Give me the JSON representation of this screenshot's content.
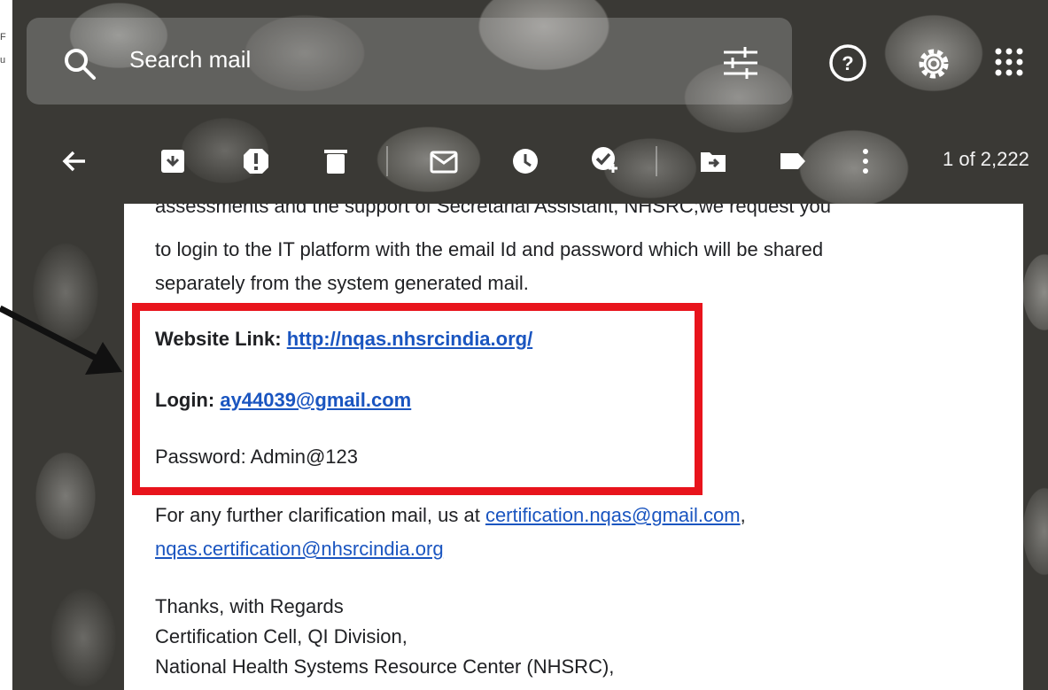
{
  "fragment_letters": [
    "F",
    "u"
  ],
  "search": {
    "placeholder": "Search mail"
  },
  "toolbar": {
    "pager": "1 of 2,222"
  },
  "email": {
    "lines": [
      "assessments and the support of Secretarial Assistant, NHSRC;we request you",
      "to login to the IT platform with the email Id and password which will be shared",
      "separately from the system generated mail."
    ],
    "website_label": "Website Link:",
    "website_link": "http://nqas.nhsrcindia.org/",
    "login_label": "Login:",
    "login_value": "ay44039@gmail.com",
    "password_line": "Password: Admin@123",
    "clarification_text": "For any further clarification mail, us at",
    "clarification_email_1": "certification.nqas@gmail.com",
    "clarification_sep": ",",
    "clarification_email_2": "nqas.certification@nhsrcindia.org",
    "signoff": [
      "Thanks, with Regards",
      "Certification Cell, QI Division,",
      "National Health Systems Resource Center (NHSRC),"
    ]
  },
  "colors": {
    "highlight_box": "#e8141c",
    "link": "#1a55c0",
    "arrow": "#111111"
  },
  "icons": [
    "search-icon",
    "tune-icon",
    "help-icon",
    "settings-icon",
    "apps-icon",
    "back-icon",
    "archive-icon",
    "report-spam-icon",
    "delete-icon",
    "mark-unread-icon",
    "snooze-icon",
    "add-task-icon",
    "move-to-icon",
    "label-icon",
    "more-vert-icon"
  ]
}
